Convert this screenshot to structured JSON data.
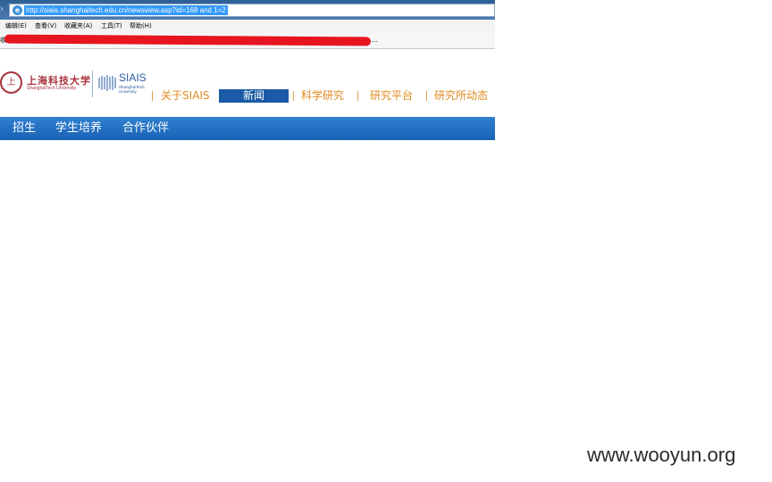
{
  "browser": {
    "url": "http://siais.shanghaitech.edu.cn/newsview.asp?id=168 and 1=2",
    "menu": [
      "编辑(E)",
      "查看(V)",
      "收藏夹(A)",
      "工具(T)",
      "帮助(H)"
    ],
    "favorites_label": "收",
    "favorites_more": "...",
    "ie_icon": "e"
  },
  "site": {
    "logo": {
      "seal_char": "上",
      "name_cn": "上海科技大学",
      "name_en": "ShanghaiTech University",
      "institute": "SIAIS",
      "institute_sub": "ShanghaiTech University"
    },
    "nav": [
      {
        "label": "关于SIAIS",
        "active": false
      },
      {
        "label": "新闻",
        "active": true
      },
      {
        "label": "科学研究",
        "active": false
      },
      {
        "label": "研究平台",
        "active": false
      },
      {
        "label": "研究所动态",
        "active": false
      }
    ],
    "subnav": [
      "招生",
      "学生培养",
      "合作伙伴"
    ]
  },
  "watermark": "www.wooyun.org",
  "colors": {
    "accent_orange": "#e08a1e",
    "nav_active_blue": "#1a5aa6",
    "brand_red": "#a8323a",
    "redaction_red": "#e6151f"
  }
}
